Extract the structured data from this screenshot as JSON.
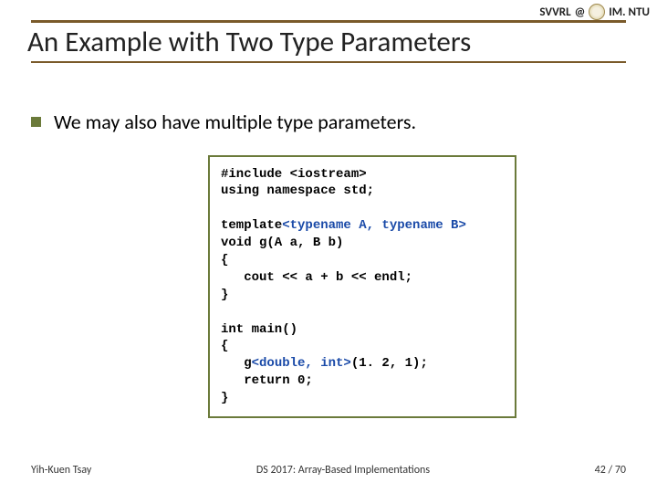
{
  "header": {
    "left": "SVVRL",
    "right": "IM. NTU"
  },
  "title": "An Example with Two Type Parameters",
  "bullet": "We may also have multiple type parameters.",
  "code": {
    "l1": "#include <iostream>",
    "l2": "using namespace std;",
    "l3a": "template",
    "l3b": "<typename A, typename B>",
    "l4": "void g(A a, B b)",
    "l5": "{",
    "l6": "   cout << a + b << endl;",
    "l7": "}",
    "l8": "int main()",
    "l9": "{",
    "l10a": "   g",
    "l10b": "<double, int>",
    "l10c": "(1. 2, 1);",
    "l11": "   return 0;",
    "l12": "}"
  },
  "footer": {
    "left": "Yih-Kuen Tsay",
    "center": "DS 2017: Array-Based Implementations",
    "right": "42 / 70"
  }
}
